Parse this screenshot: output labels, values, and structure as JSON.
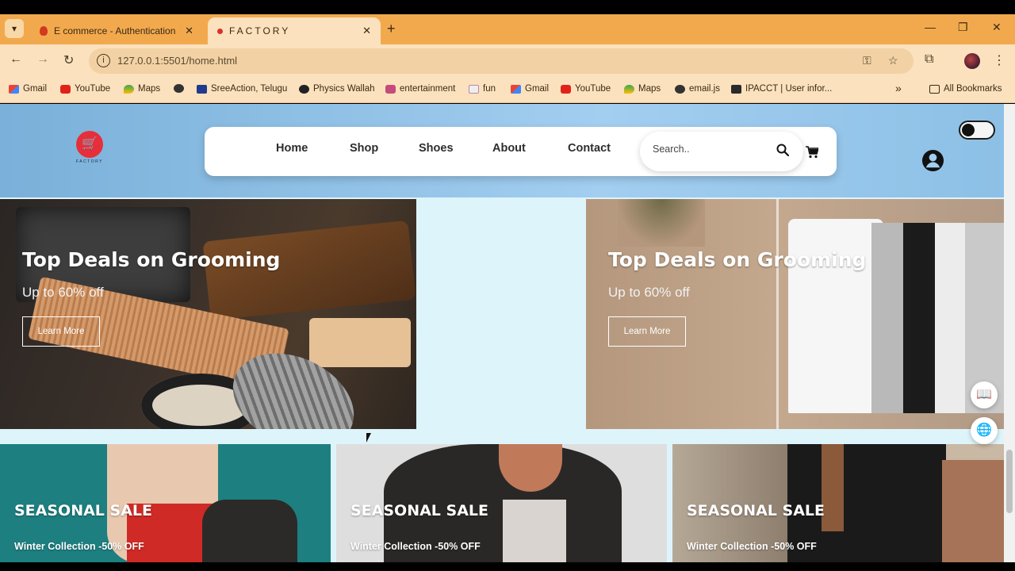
{
  "browser": {
    "tabs": [
      {
        "title": "E commerce - Authentication -",
        "active": false
      },
      {
        "title": "FACTORY",
        "active": true
      }
    ],
    "new_tab": "+",
    "tab_close": "✕",
    "window_controls": {
      "minimize": "—",
      "restore": "❐",
      "close": "✕"
    },
    "url": "127.0.0.1:5501/home.html",
    "bookmarks": [
      {
        "label": "Gmail",
        "icon": "gmail-icon"
      },
      {
        "label": "YouTube",
        "icon": "youtube-icon"
      },
      {
        "label": "Maps",
        "icon": "maps-icon"
      },
      {
        "label": "",
        "icon": "globe-icon"
      },
      {
        "label": "SreeAction, Telugu",
        "icon": "sreeaction-icon"
      },
      {
        "label": "Physics Wallah",
        "icon": "physics-wallah-icon"
      },
      {
        "label": "entertainment",
        "icon": "entertainment-icon"
      },
      {
        "label": "fun",
        "icon": "fun-icon"
      },
      {
        "label": "Gmail",
        "icon": "gmail-icon"
      },
      {
        "label": "YouTube",
        "icon": "youtube-icon"
      },
      {
        "label": "Maps",
        "icon": "maps-icon"
      },
      {
        "label": "email.js",
        "icon": "globe-icon"
      },
      {
        "label": "IPACCT | User infor...",
        "icon": "ipacct-icon"
      }
    ],
    "more_bookmarks": "»",
    "all_bookmarks": "All Bookmarks"
  },
  "site": {
    "logo_text": "FACTORY",
    "nav": [
      "Home",
      "Shop",
      "Shoes",
      "About",
      "Contact"
    ],
    "search_placeholder": "Search..",
    "banners": [
      {
        "title": "Top Deals on Grooming",
        "subtitle": "Up to 60% off",
        "button": "Learn More"
      },
      {
        "title": "Top Deals on Grooming",
        "subtitle": "Up to 60% off",
        "button": "Learn More"
      }
    ],
    "cards": [
      {
        "title": "SEASONAL SALE",
        "subtitle": "Winter Collection -50% OFF"
      },
      {
        "title": "SEASONAL SALE",
        "subtitle": "Winter Collection -50% OFF"
      },
      {
        "title": "SEASONAL SALE",
        "subtitle": "Winter Collection -50% OFF"
      }
    ]
  },
  "colors": {
    "chrome": "#f2a94e",
    "toolbar": "#fbe1bd",
    "header_gradient_start": "#7ab0d9",
    "page_bg": "#def4fb",
    "logo_red": "#e62f3a"
  }
}
